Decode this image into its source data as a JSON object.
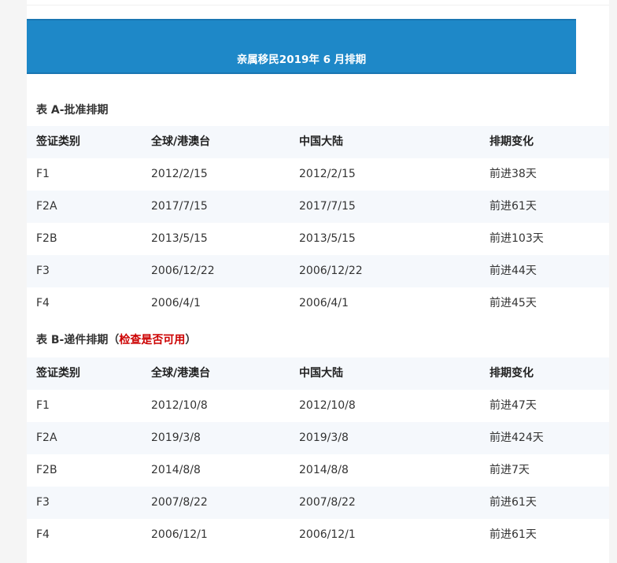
{
  "banner": {
    "title": "亲属移民2019年 6 月排期"
  },
  "tableA": {
    "title": "表 A-批准排期",
    "headers": [
      "签证类别",
      "全球/港澳台",
      "中国大陆",
      "排期变化"
    ],
    "rows": [
      [
        "F1",
        "2012/2/15",
        "2012/2/15",
        "前进38天"
      ],
      [
        "F2A",
        "2017/7/15",
        "2017/7/15",
        "前进61天"
      ],
      [
        "F2B",
        "2013/5/15",
        "2013/5/15",
        "前进103天"
      ],
      [
        "F3",
        "2006/12/22",
        "2006/12/22",
        "前进44天"
      ],
      [
        "F4",
        "2006/4/1",
        "2006/4/1",
        "前进45天"
      ]
    ]
  },
  "tableB": {
    "title_prefix": "表 B-递件排期（",
    "title_link": "检查是否可用",
    "title_suffix": "）",
    "headers": [
      "签证类别",
      "全球/港澳台",
      "中国大陆",
      "排期变化"
    ],
    "rows": [
      [
        "F1",
        "2012/10/8",
        "2012/10/8",
        "前进47天"
      ],
      [
        "F2A",
        "2019/3/8",
        "2019/3/8",
        "前进424天"
      ],
      [
        "F2B",
        "2014/8/8",
        "2014/8/8",
        "前进7天"
      ],
      [
        "F3",
        "2007/8/22",
        "2007/8/22",
        "前进61天"
      ],
      [
        "F4",
        "2006/12/1",
        "2006/12/1",
        "前进61天"
      ]
    ]
  },
  "colors": {
    "banner": "#1e88c8",
    "link": "#cc0000",
    "stripe": "#f5f8fc"
  }
}
